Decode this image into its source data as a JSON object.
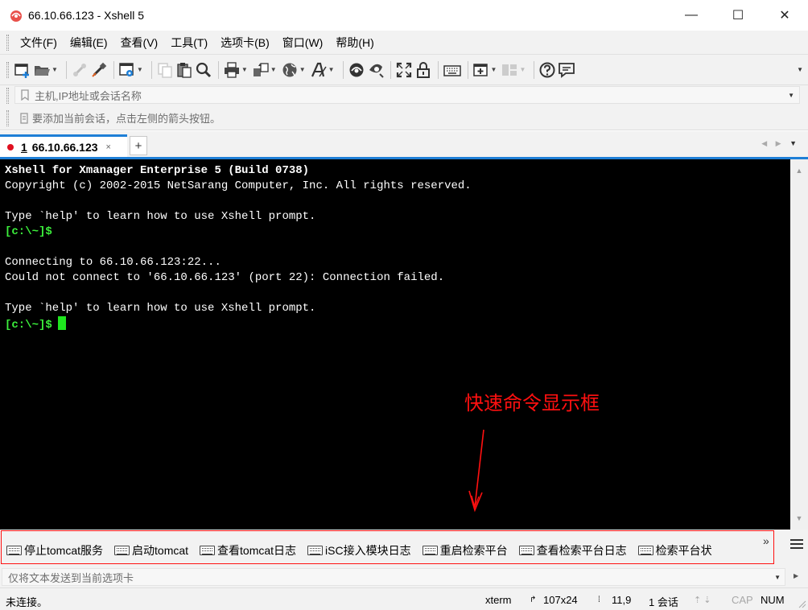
{
  "window": {
    "title": "66.10.66.123 - Xshell 5",
    "minimize": "—",
    "maximize": "☐",
    "close": "✕"
  },
  "menu": [
    "文件(F)",
    "编辑(E)",
    "查看(V)",
    "工具(T)",
    "选项卡(B)",
    "窗口(W)",
    "帮助(H)"
  ],
  "toolbar": {
    "icons": [
      "new-session-icon",
      "open-folder-icon",
      "disconnect-icon",
      "reconnect-icon",
      "properties-icon",
      "copy-icon",
      "paste-icon",
      "find-icon",
      "print-icon",
      "transfer-icon",
      "globe-icon",
      "font-icon",
      "xftp-icon",
      "xmanager-icon",
      "fullscreen-icon",
      "lock-icon",
      "keyboard-icon",
      "new-tab-icon",
      "layout-icon",
      "help-icon",
      "chat-icon"
    ]
  },
  "address": {
    "placeholder": "主机,IP地址或会话名称"
  },
  "hint": {
    "text": "要添加当前会话，点击左侧的箭头按钮。"
  },
  "tabs": {
    "active": {
      "number": "1",
      "label": "66.10.66.123",
      "close": "×"
    },
    "add": "+"
  },
  "terminal": {
    "lines": [
      {
        "text": "Xshell for Xmanager Enterprise 5 (Build 0738)",
        "bold": true
      },
      {
        "text": "Copyright (c) 2002-2015 NetSarang Computer, Inc. All rights reserved."
      },
      {
        "text": ""
      },
      {
        "text": "Type `help' to learn how to use Xshell prompt."
      },
      {
        "text": "[c:\\~]$",
        "prompt": true
      },
      {
        "text": ""
      },
      {
        "text": "Connecting to 66.10.66.123:22..."
      },
      {
        "text": "Could not connect to '66.10.66.123' (port 22): Connection failed."
      },
      {
        "text": ""
      },
      {
        "text": "Type `help' to learn how to use Xshell prompt."
      },
      {
        "text": "[c:\\~]$",
        "prompt": true,
        "cursor": true
      }
    ]
  },
  "annotation": {
    "text": "快速命令显示框",
    "color": "#ff1010"
  },
  "quick_commands": {
    "buttons": [
      "停止tomcat服务",
      "启动tomcat",
      "查看tomcat日志",
      "iSC接入模块日志",
      "重启检索平台",
      "查看检索平台日志",
      "检索平台状"
    ],
    "more": "»"
  },
  "send": {
    "placeholder": "仅将文本发送到当前选项卡"
  },
  "status": {
    "connection": "未连接。",
    "terminal_type": "xterm",
    "size": "107x24",
    "cursor_pos": "11,9",
    "sessions": "1 会话",
    "caps": "CAP",
    "num": "NUM"
  },
  "colors": {
    "accent": "#1e7fd6",
    "prompt": "#3cf03c",
    "annotation": "#ff1010",
    "terminal_bg": "#000000"
  }
}
